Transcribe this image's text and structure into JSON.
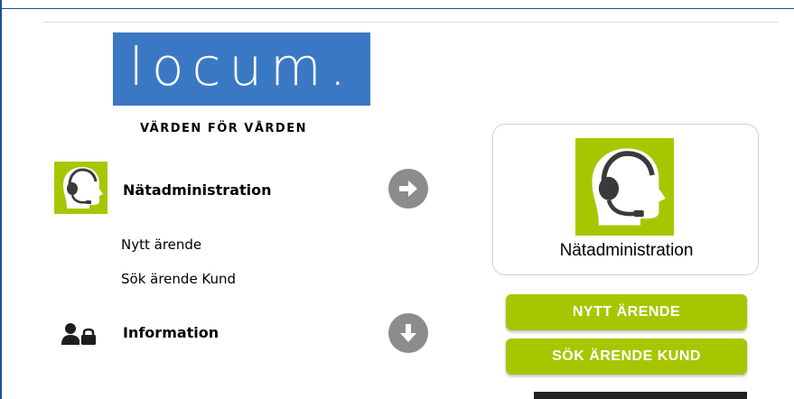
{
  "brand": {
    "logo_text": "locum.",
    "tagline": "VÄRDEN FÖR VÅRDEN",
    "color": "#3b78c4"
  },
  "theme": {
    "accent": "#a8c600",
    "arrow": "#8c8c8c"
  },
  "menu": {
    "network": {
      "title": "Nätadministration",
      "icon": "headset-agent-icon",
      "arrow_icon": "arrow-right-circle-icon",
      "links": [
        "Nytt ärende",
        "Sök ärende Kund"
      ]
    },
    "information": {
      "title": "Information",
      "icon": "user-lock-icon",
      "arrow_icon": "arrow-down-circle-icon"
    }
  },
  "card": {
    "label": "Nätadministration",
    "icon": "headset-agent-icon"
  },
  "actions": {
    "new_case": "NYTT ÄRENDE",
    "search_case": "SÖK ÄRENDE KUND"
  }
}
